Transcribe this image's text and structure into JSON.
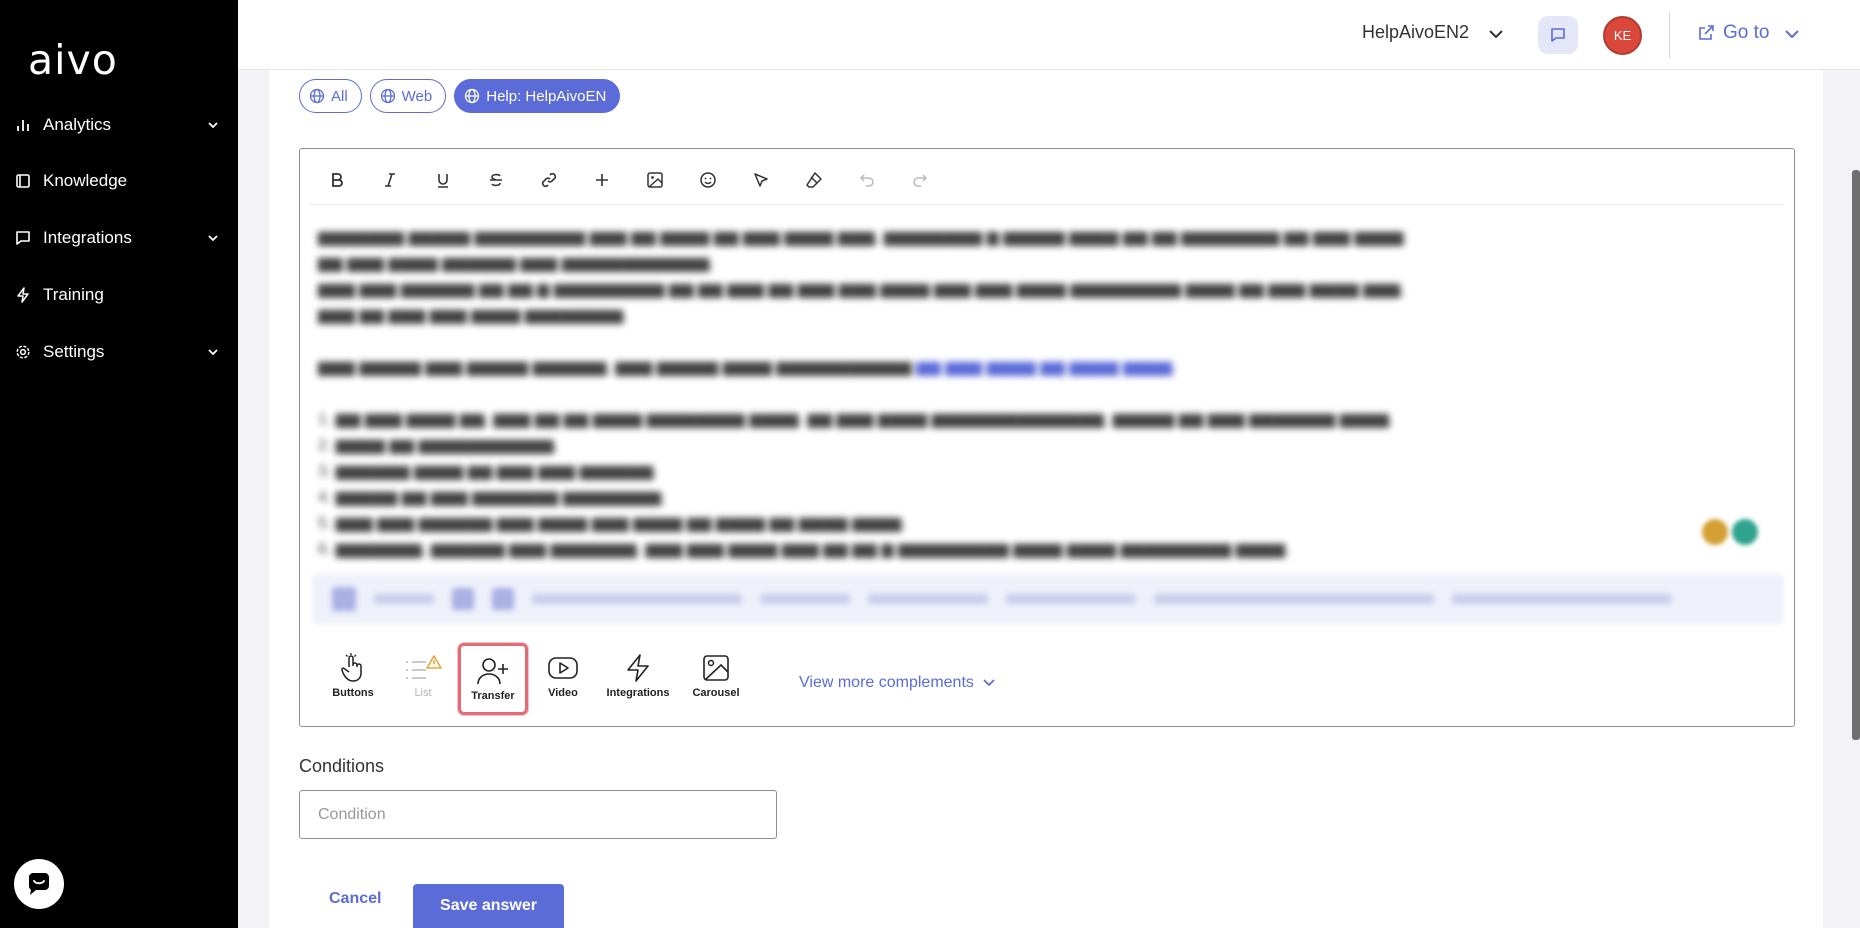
{
  "brand": {
    "logo": "aivo"
  },
  "sidebar": {
    "items": [
      {
        "label": "Analytics",
        "icon": "bar-chart-icon",
        "expandable": true
      },
      {
        "label": "Knowledge",
        "icon": "book-icon",
        "expandable": false
      },
      {
        "label": "Integrations",
        "icon": "message-square-icon",
        "expandable": true
      },
      {
        "label": "Training",
        "icon": "zap-icon",
        "expandable": false
      },
      {
        "label": "Settings",
        "icon": "gear-icon",
        "expandable": true
      }
    ]
  },
  "topbar": {
    "workspace": "HelpAivoEN2",
    "avatar_initials": "KE",
    "goto_label": "Go to"
  },
  "filters": {
    "chips": [
      {
        "label": "All",
        "active": false
      },
      {
        "label": "Web",
        "active": false
      },
      {
        "label": "Help: HelpAivoEN",
        "active": true
      }
    ]
  },
  "editor": {
    "toolbar": [
      "bold",
      "italic",
      "underline",
      "strikethrough",
      "link",
      "add",
      "image",
      "emoji",
      "pointer",
      "eraser",
      "undo",
      "redo"
    ]
  },
  "complements": {
    "items": [
      {
        "label": "Buttons",
        "icon": "hand-pointer-icon",
        "state": "normal"
      },
      {
        "label": "List",
        "icon": "list-warning-icon",
        "state": "disabled"
      },
      {
        "label": "Transfer",
        "icon": "user-plus-icon",
        "state": "selected"
      },
      {
        "label": "Video",
        "icon": "youtube-icon",
        "state": "normal"
      },
      {
        "label": "Integrations",
        "icon": "zap-icon",
        "state": "normal"
      },
      {
        "label": "Carousel",
        "icon": "image-icon",
        "state": "normal"
      }
    ],
    "view_more": "View more complements"
  },
  "conditions": {
    "label": "Conditions",
    "placeholder": "Condition",
    "value": ""
  },
  "actions": {
    "cancel": "Cancel",
    "save": "Save answer"
  },
  "colors": {
    "accent": "#5b6bd8",
    "sidebar_bg": "#000000",
    "avatar_bg": "#d9483b",
    "selected_border": "#e36b78"
  }
}
